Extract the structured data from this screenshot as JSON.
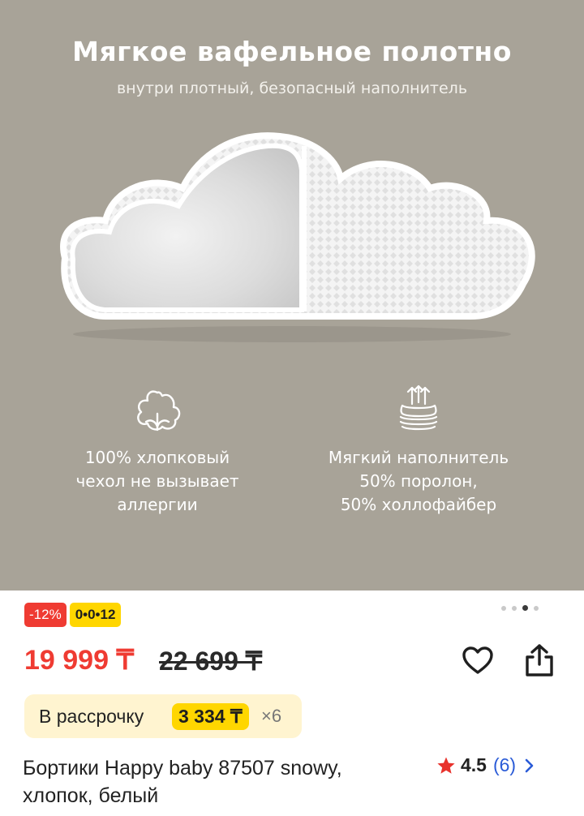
{
  "hero": {
    "title": "Мягкое вафельное полотно",
    "subtitle": "внутри плотный, безопасный наполнитель",
    "background_color": "#a8a398",
    "features": [
      {
        "icon": "cotton-flower-icon",
        "lines": [
          "100% хлопковый",
          "чехол не вызывает",
          "аллергии"
        ]
      },
      {
        "icon": "breathable-layers-icon",
        "lines": [
          "Мягкий наполнитель",
          "50% поролон,",
          "50% холлофайбер"
        ]
      }
    ]
  },
  "carousel": {
    "total": 4,
    "active_index": 2
  },
  "badges": {
    "discount": "-12%",
    "installment_plan": "0•0•12"
  },
  "price": {
    "current": "19 999 ₸",
    "old": "22 699 ₸",
    "current_color": "#ef3b32"
  },
  "installment": {
    "label": "В рассрочку",
    "amount": "3 334 ₸",
    "multiplier": "×6"
  },
  "product": {
    "title_lines": [
      "Бортики Happy baby 87507 snowy,",
      "хлопок, белый"
    ]
  },
  "rating": {
    "value": "4.5",
    "count": "(6)",
    "star_color": "#e8322c"
  },
  "actions": {
    "favorite_icon": "heart-icon",
    "share_icon": "share-icon"
  }
}
